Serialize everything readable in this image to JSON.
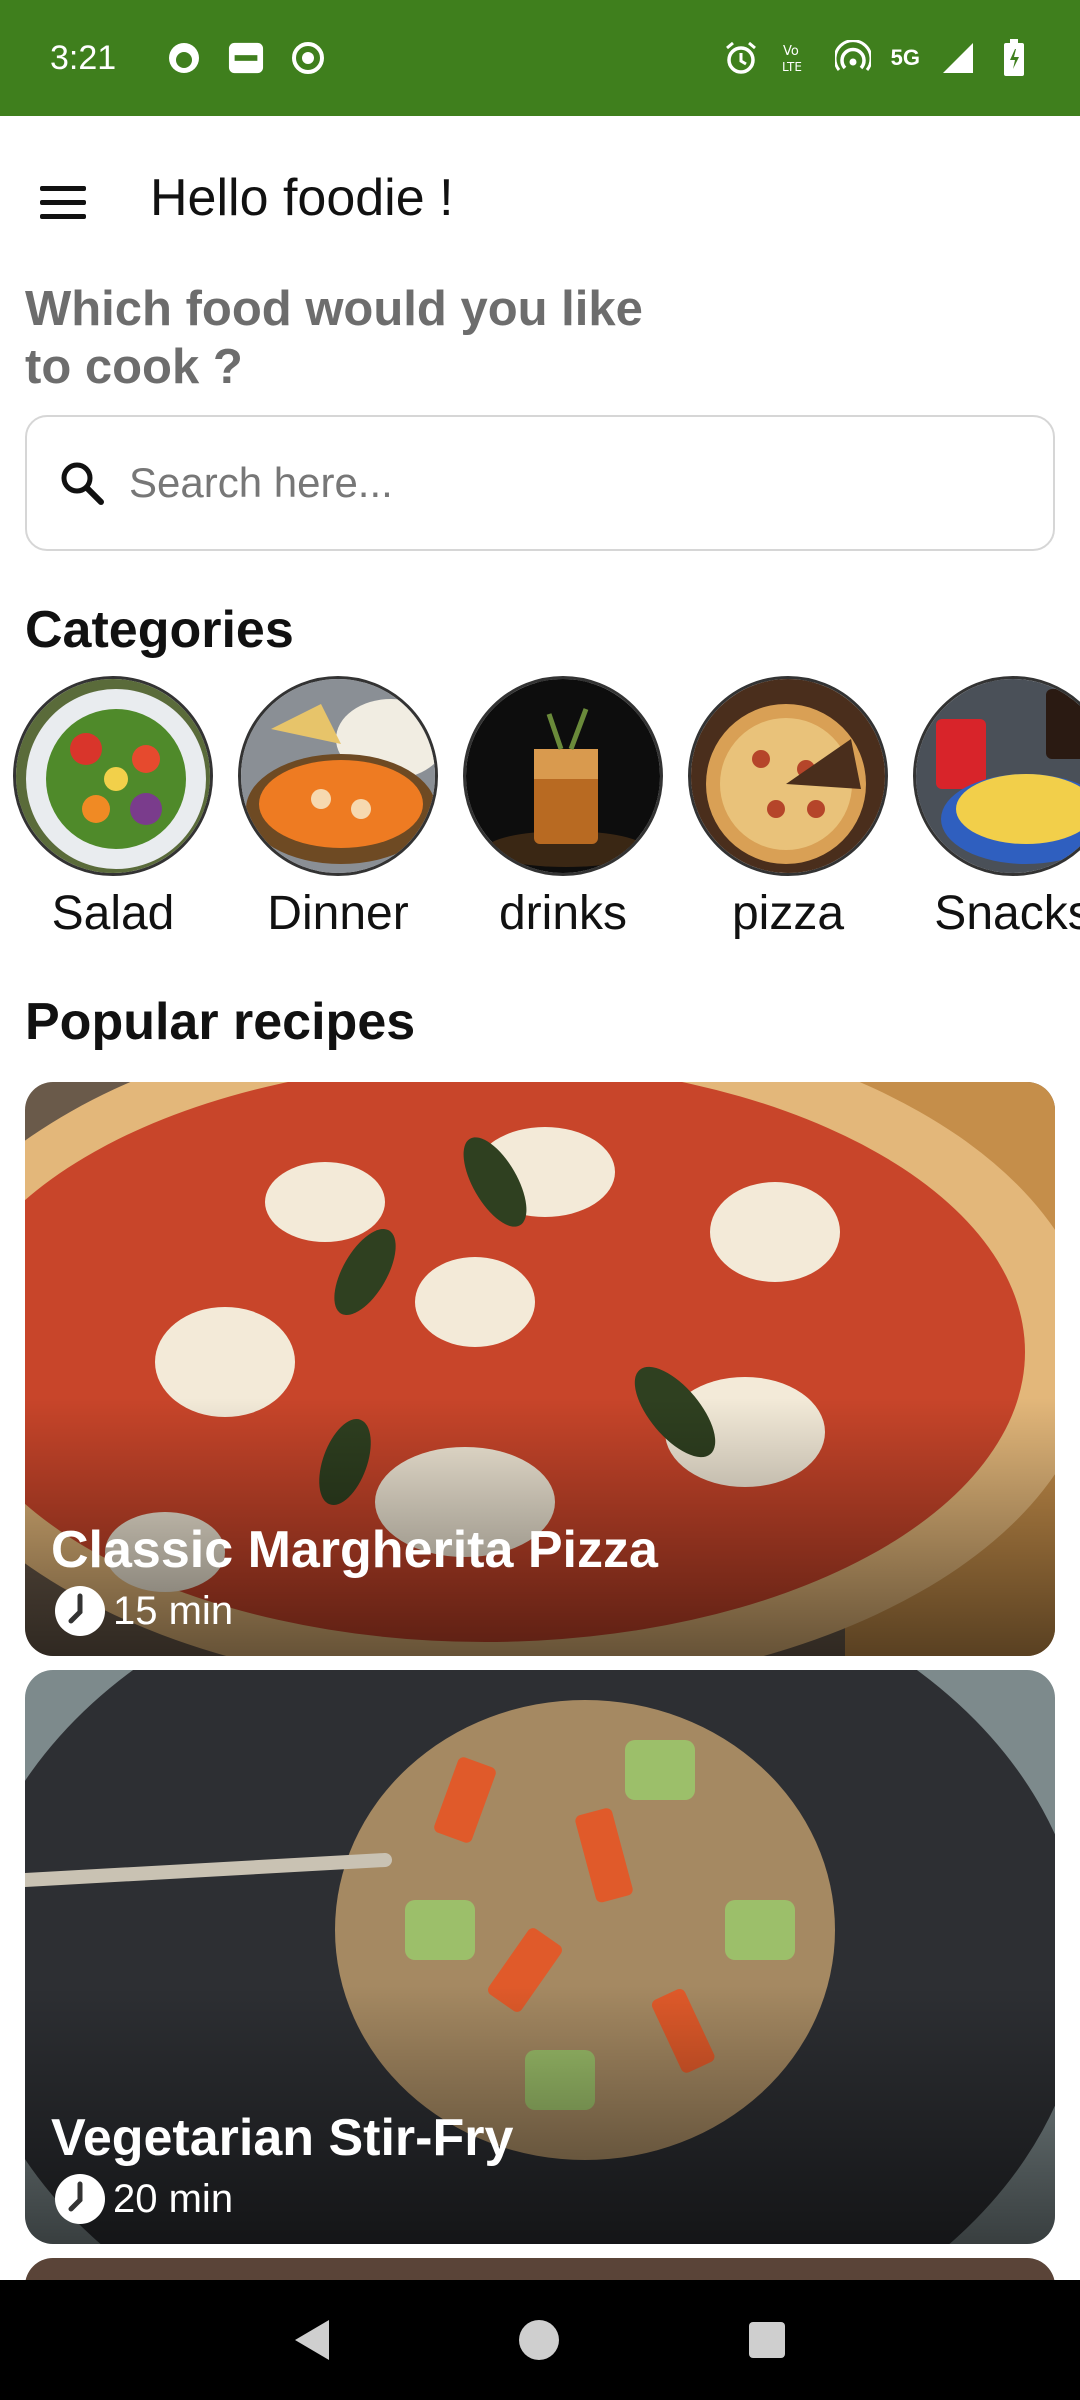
{
  "status_bar": {
    "time": "3:21",
    "left_icons": [
      "notification-app-icon",
      "paytm-icon",
      "screen-record-icon"
    ],
    "network": "5G",
    "right_icons": [
      "alarm-icon",
      "volte-icon",
      "hotspot-icon",
      "signal-icon",
      "battery-icon"
    ]
  },
  "header": {
    "greeting": "Hello foodie !"
  },
  "prompt": {
    "line": "Which food would you like to cook ?"
  },
  "search": {
    "placeholder": "Search here..."
  },
  "categories": {
    "title": "Categories",
    "items": [
      {
        "label": "Salad"
      },
      {
        "label": "Dinner"
      },
      {
        "label": "drinks"
      },
      {
        "label": "pizza"
      },
      {
        "label": "Snacks"
      }
    ]
  },
  "popular": {
    "title": "Popular recipes",
    "recipes": [
      {
        "name": "Classic Margherita Pizza",
        "time": "15 min"
      },
      {
        "name": "Vegetarian Stir-Fry",
        "time": "20 min"
      }
    ]
  },
  "colors": {
    "status_bar": "#3f7f1d",
    "subtitle": "#6d6d6d"
  }
}
